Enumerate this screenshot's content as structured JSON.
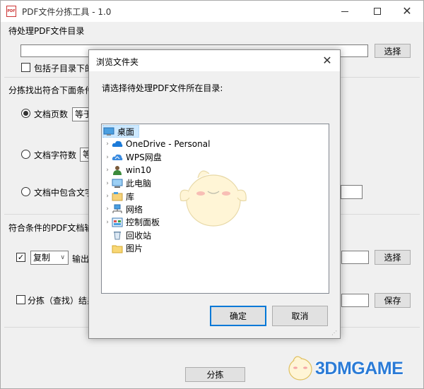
{
  "window": {
    "title": "PDF文件分拣工具 - 1.0",
    "icon_label": "PDF"
  },
  "main": {
    "source_dir_label": "待处理PDF文件目录",
    "select_button": "选择",
    "include_subdirs_label": "包括子目录下的",
    "criteria_label": "分拣找出符合下面条件",
    "page_count_label": "文档页数",
    "page_count_op": "等于",
    "char_count_label": "文档字符数",
    "char_count_op": "等",
    "contains_text_label": "文档中包含文字",
    "output_section_label": "符合条件的PDF文档输出",
    "action_option": "复制",
    "output_label": "输出",
    "output_select_button": "选择",
    "result_label": "分拣（查找）结果",
    "save_button": "保存",
    "sort_button": "分拣"
  },
  "dialog": {
    "title": "浏览文件夹",
    "prompt": "请选择待处理PDF文件所在目录:",
    "tree": [
      {
        "label": "桌面",
        "icon": "desktop-icon",
        "expandable": false,
        "selected": true,
        "indent": 0
      },
      {
        "label": "OneDrive - Personal",
        "icon": "onedrive-cloud-icon",
        "expandable": true,
        "selected": false,
        "indent": 1
      },
      {
        "label": "WPS网盘",
        "icon": "wps-cloud-icon",
        "expandable": true,
        "selected": false,
        "indent": 1
      },
      {
        "label": "win10",
        "icon": "user-icon",
        "expandable": true,
        "selected": false,
        "indent": 1
      },
      {
        "label": "此电脑",
        "icon": "computer-icon",
        "expandable": true,
        "selected": false,
        "indent": 1
      },
      {
        "label": "库",
        "icon": "library-icon",
        "expandable": true,
        "selected": false,
        "indent": 1
      },
      {
        "label": "网络",
        "icon": "network-icon",
        "expandable": true,
        "selected": false,
        "indent": 1
      },
      {
        "label": "控制面板",
        "icon": "control-panel-icon",
        "expandable": true,
        "selected": false,
        "indent": 1
      },
      {
        "label": "回收站",
        "icon": "recycle-bin-icon",
        "expandable": false,
        "selected": false,
        "indent": 1
      },
      {
        "label": "图片",
        "icon": "folder-icon",
        "expandable": false,
        "selected": false,
        "indent": 1
      }
    ],
    "ok_button": "确定",
    "cancel_button": "取消"
  },
  "watermark": {
    "text": "3DMGAME"
  },
  "colors": {
    "selection": "#cce8ff",
    "accent": "#0078d7",
    "watermark_blue": "#2b7bd6"
  }
}
